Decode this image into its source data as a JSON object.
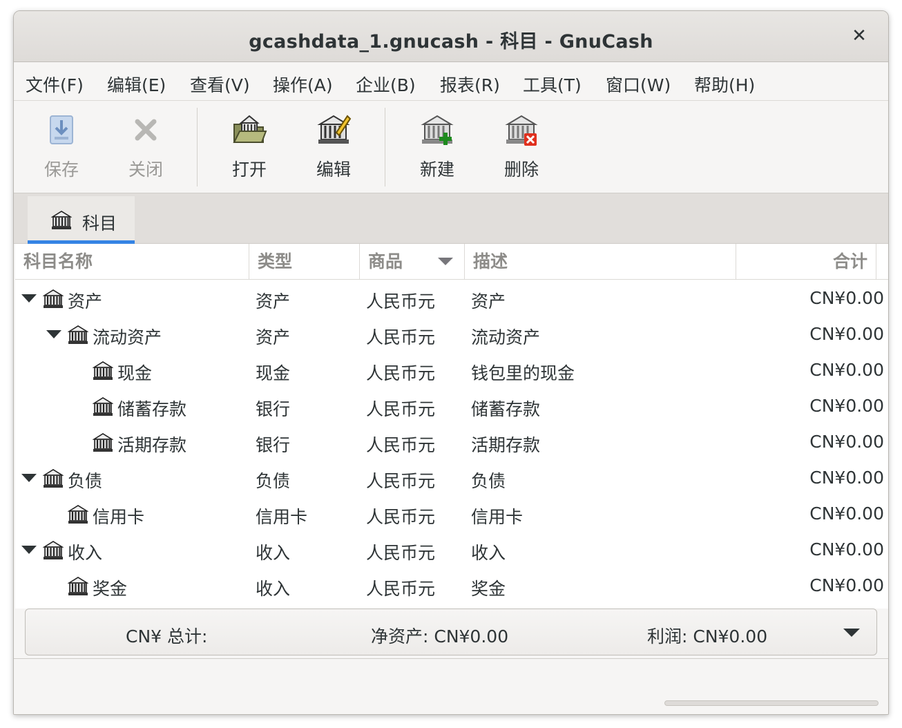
{
  "window": {
    "title": "gcashdata_1.gnucash - 科目 - GnuCash",
    "close_glyph": "✕"
  },
  "menubar": {
    "items": [
      {
        "label": "文件(F)"
      },
      {
        "label": "编辑(E)"
      },
      {
        "label": "查看(V)"
      },
      {
        "label": "操作(A)"
      },
      {
        "label": "企业(B)"
      },
      {
        "label": "报表(R)"
      },
      {
        "label": "工具(T)"
      },
      {
        "label": "窗口(W)"
      },
      {
        "label": "帮助(H)"
      }
    ]
  },
  "toolbar": {
    "save": {
      "label": "保存",
      "icon": "save-icon",
      "enabled": false
    },
    "close": {
      "label": "关闭",
      "icon": "close-icon",
      "enabled": false
    },
    "open": {
      "label": "打开",
      "icon": "open-account-icon",
      "enabled": true
    },
    "edit": {
      "label": "编辑",
      "icon": "edit-account-icon",
      "enabled": true
    },
    "new": {
      "label": "新建",
      "icon": "new-account-icon",
      "enabled": true
    },
    "delete": {
      "label": "删除",
      "icon": "delete-account-icon",
      "enabled": true
    }
  },
  "tabs": [
    {
      "label": "科目",
      "icon": "account-icon",
      "active": true
    }
  ],
  "tree": {
    "columns": {
      "name": "科目名称",
      "type": "类型",
      "commodity": "商品",
      "description": "描述",
      "total": "合计"
    },
    "rows": [
      {
        "name": "资产",
        "type": "资产",
        "commodity": "人民币元",
        "description": "资产",
        "total": "CN¥0.00",
        "expanded": true
      },
      {
        "name": "流动资产",
        "type": "资产",
        "commodity": "人民币元",
        "description": "流动资产",
        "total": "CN¥0.00",
        "expanded": true
      },
      {
        "name": "现金",
        "type": "现金",
        "commodity": "人民币元",
        "description": "钱包里的现金",
        "total": "CN¥0.00",
        "expanded": false
      },
      {
        "name": "储蓄存款",
        "type": "银行",
        "commodity": "人民币元",
        "description": "储蓄存款",
        "total": "CN¥0.00",
        "expanded": false
      },
      {
        "name": "活期存款",
        "type": "银行",
        "commodity": "人民币元",
        "description": "活期存款",
        "total": "CN¥0.00",
        "expanded": false
      },
      {
        "name": "负债",
        "type": "负债",
        "commodity": "人民币元",
        "description": "负债",
        "total": "CN¥0.00",
        "expanded": true
      },
      {
        "name": "信用卡",
        "type": "信用卡",
        "commodity": "人民币元",
        "description": "信用卡",
        "total": "CN¥0.00",
        "expanded": false
      },
      {
        "name": "收入",
        "type": "收入",
        "commodity": "人民币元",
        "description": "收入",
        "total": "CN¥0.00",
        "expanded": true
      },
      {
        "name": "奖金",
        "type": "收入",
        "commodity": "人民币元",
        "description": "奖金",
        "total": "CN¥0.00",
        "expanded": false
      }
    ]
  },
  "summary": {
    "label": "CN¥ 总计:",
    "net_assets": "净资产:  CN¥0.00",
    "profit": "利润:  CN¥0.00"
  },
  "colors": {
    "accent": "#3584e4",
    "window_bg": "#f6f5f4"
  }
}
